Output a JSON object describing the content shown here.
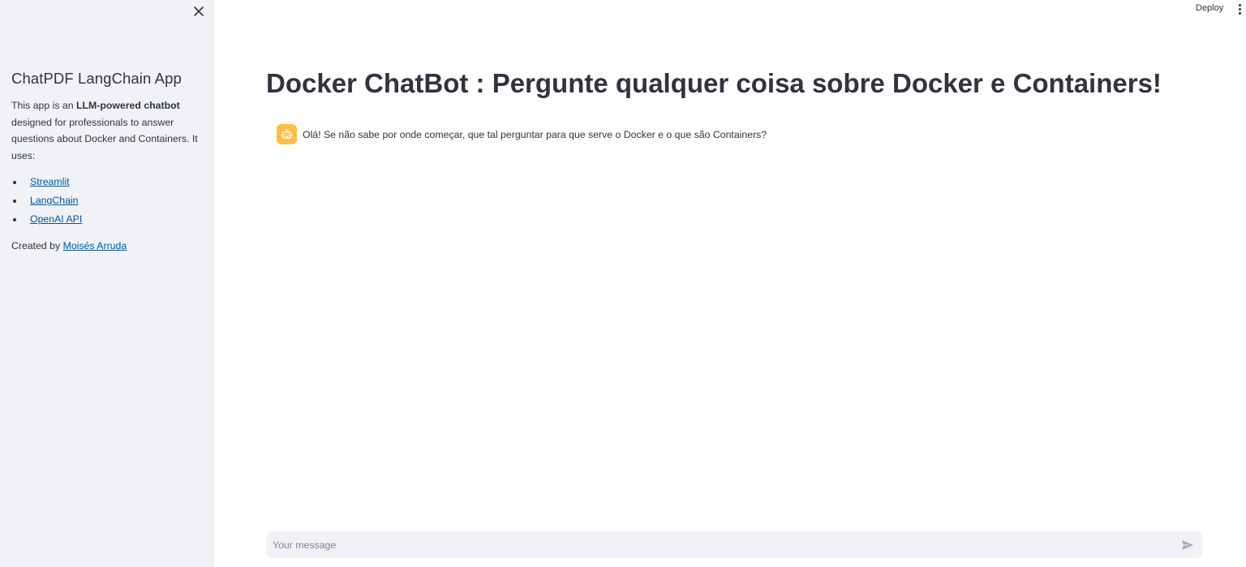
{
  "sidebar": {
    "title": "ChatPDF LangChain App",
    "desc_prefix": "This app is an ",
    "desc_bold": "LLM-powered chatbot",
    "desc_suffix": " designed for professionals to answer questions about Docker and Containers. It uses:",
    "items": [
      {
        "label": "Streamlit"
      },
      {
        "label": "LangChain"
      },
      {
        "label": "OpenAI API"
      }
    ],
    "created_prefix": "Created by ",
    "created_link": "Moisés Arruda"
  },
  "toolbar": {
    "deploy_label": "Deploy"
  },
  "main": {
    "title": "Docker ChatBot : Pergunte qualquer coisa sobre Docker e Containers!",
    "messages": [
      {
        "role": "assistant",
        "text": "Olá! Se não sabe por onde começar, que tal perguntar para que serve o Docker e o que são Containers?"
      }
    ]
  },
  "chat_input": {
    "placeholder": "Your message",
    "value": ""
  },
  "colors": {
    "sidebar_bg": "#f0f2f6",
    "avatar_bg": "#ffbd45",
    "link": "#0054a3",
    "text": "#31333f"
  }
}
